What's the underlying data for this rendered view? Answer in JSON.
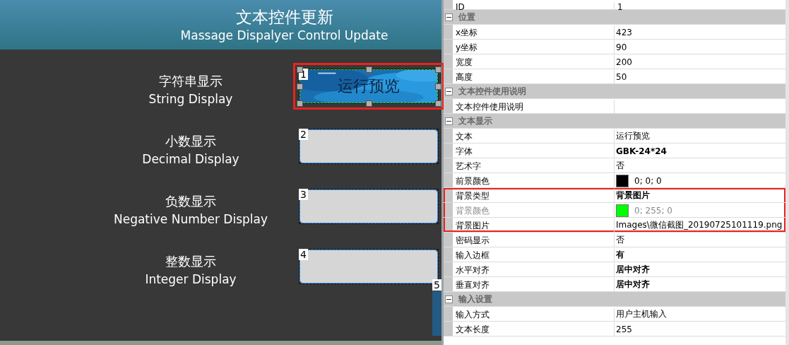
{
  "canvas": {
    "title": "文本控件更新",
    "subtitle": "Massage Dispalyer Control Update",
    "rows": [
      {
        "label": "字符串显示",
        "label_en": "String Display",
        "index": "1",
        "text": "运行预览",
        "selected": true
      },
      {
        "label": "小数显示",
        "label_en": "Decimal Display",
        "index": "2",
        "kind": "blank",
        "selected": false
      },
      {
        "label": "负数显示",
        "label_en": "Negative Number Display",
        "index": "3",
        "kind": "blank",
        "selected": false
      },
      {
        "label": "整数显示",
        "label_en": "Integer Display",
        "index": "4",
        "kind": "blank",
        "selected": false
      }
    ],
    "partial_control": {
      "index": "5"
    }
  },
  "properties": {
    "top_row": {
      "name": "ID",
      "value": "1"
    },
    "categories": [
      {
        "title": "位置",
        "expanded": true,
        "items": [
          {
            "name": "x坐标",
            "value": "423"
          },
          {
            "name": "y坐标",
            "value": "90"
          },
          {
            "name": "宽度",
            "value": "200"
          },
          {
            "name": "高度",
            "value": "50"
          }
        ]
      },
      {
        "title": "文本控件使用说明",
        "expanded": true,
        "items": [
          {
            "name": "文本控件使用说明"
          }
        ]
      },
      {
        "title": "文本显示",
        "expanded": true,
        "items": [
          {
            "name": "文本",
            "value": "运行预览"
          },
          {
            "name": "字体",
            "value": "GBK-24*24",
            "modified": true
          },
          {
            "name": "艺术字",
            "value": "否"
          },
          {
            "name": "前景颜色",
            "value": "0; 0; 0",
            "color": "#000000"
          },
          {
            "name": "背景类型",
            "value": "背景图片",
            "modified": true,
            "highlighted": true
          },
          {
            "name": "背景颜色",
            "value": "0; 255; 0",
            "color": "#00ff00",
            "disabled": true,
            "highlighted": true
          },
          {
            "name": "背景图片",
            "value": "Images\\微信截图_20190725101119.png",
            "highlighted": true
          },
          {
            "name": "密码显示",
            "value": "否"
          },
          {
            "name": "输入边框",
            "value": "有",
            "modified": true
          },
          {
            "name": "水平对齐",
            "value": "居中对齐",
            "modified": true
          },
          {
            "name": "垂直对齐",
            "value": "居中对齐",
            "modified": true
          }
        ]
      },
      {
        "title": "输入设置",
        "expanded": true,
        "items": [
          {
            "name": "输入方式",
            "value": "用户主机输入"
          },
          {
            "name": "文本长度",
            "value": "255"
          }
        ]
      }
    ]
  }
}
